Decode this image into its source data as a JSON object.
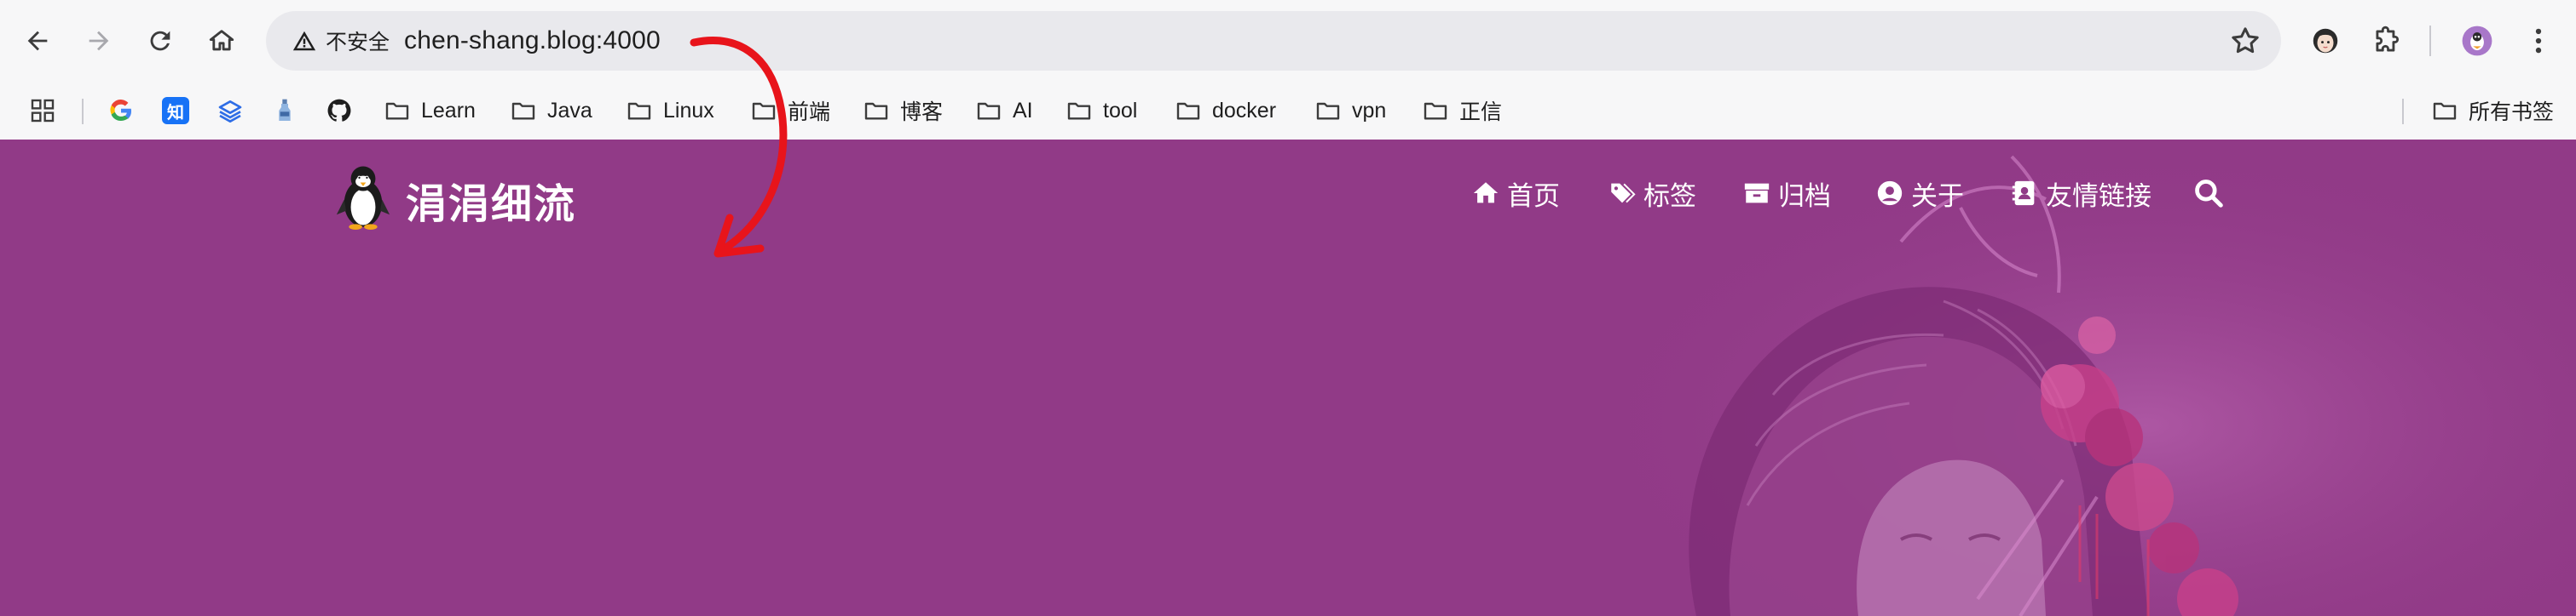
{
  "browser": {
    "security_label": "不安全",
    "url": "chen-shang.blog:4000",
    "icons": {
      "back": "back-arrow-icon",
      "forward": "forward-arrow-icon",
      "reload": "reload-icon",
      "home": "home-icon",
      "warning": "warning-triangle-icon",
      "bookmark": "star-icon",
      "extensions": "puzzle-icon",
      "profile": "avatar",
      "menu": "kebab-menu-icon"
    }
  },
  "bookmarks": {
    "items": [
      {
        "icon": "apps-grid-icon",
        "label": ""
      },
      {
        "icon": "google-icon",
        "label": ""
      },
      {
        "icon": "zhihu-icon",
        "label": "知"
      },
      {
        "icon": "layers-icon",
        "label": ""
      },
      {
        "icon": "bottle-icon",
        "label": ""
      },
      {
        "icon": "github-icon",
        "label": ""
      },
      {
        "icon": "folder-icon",
        "label": "Learn"
      },
      {
        "icon": "folder-icon",
        "label": "Java"
      },
      {
        "icon": "folder-icon",
        "label": "Linux"
      },
      {
        "icon": "folder-icon",
        "label": "前端"
      },
      {
        "icon": "folder-icon",
        "label": "博客"
      },
      {
        "icon": "folder-icon",
        "label": "AI"
      },
      {
        "icon": "folder-icon",
        "label": "tool"
      },
      {
        "icon": "folder-icon",
        "label": "docker"
      },
      {
        "icon": "folder-icon",
        "label": "vpn"
      },
      {
        "icon": "folder-icon",
        "label": "正信"
      }
    ],
    "all_bookmarks_label": "所有书签"
  },
  "site": {
    "title": "涓涓细流",
    "logo": "penguin-logo",
    "nav": [
      {
        "icon": "home-icon",
        "label": "首页"
      },
      {
        "icon": "tag-icon",
        "label": "标签"
      },
      {
        "icon": "archive-icon",
        "label": "归档"
      },
      {
        "icon": "user-circle-icon",
        "label": "关于"
      },
      {
        "icon": "contact-card-icon",
        "label": "友情链接"
      }
    ],
    "search_icon": "search-icon"
  },
  "colors": {
    "hero_background": "#913a87",
    "annotation_arrow": "#e8141b",
    "browser_chrome": "#f7f7f8",
    "omnibox": "#e9e9ed"
  }
}
